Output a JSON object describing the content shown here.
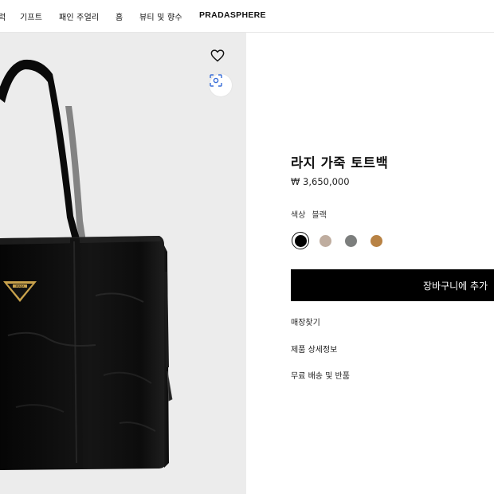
{
  "nav": {
    "items": [
      "럭",
      "기프트",
      "패인 주얼리",
      "홈",
      "뷰티 및 향수"
    ],
    "brand": "PRADASPHERE"
  },
  "product": {
    "title": "라지 가죽 토트백",
    "price": "₩ 3,650,000",
    "color_label": "색상",
    "color_value": "블랙",
    "swatches": [
      {
        "name": "black",
        "color": "#000000",
        "selected": true
      },
      {
        "name": "taupe",
        "color": "#bfad9f",
        "selected": false
      },
      {
        "name": "gray",
        "color": "#7c7e7d",
        "selected": false
      },
      {
        "name": "tan",
        "color": "#b88244",
        "selected": false
      }
    ],
    "add_to_bag_label": "장바구니에 추가",
    "links": {
      "store_finder": "매장찾기",
      "product_details": "제품 상세정보",
      "shipping_returns": "무료 배송 및 반품"
    }
  },
  "image": {
    "logo_text": "PRADA",
    "bag_color": "#0a0a0a",
    "background": "#ececec"
  },
  "icons": {
    "wishlist": "heart-icon",
    "visual_search": "scan-icon"
  }
}
